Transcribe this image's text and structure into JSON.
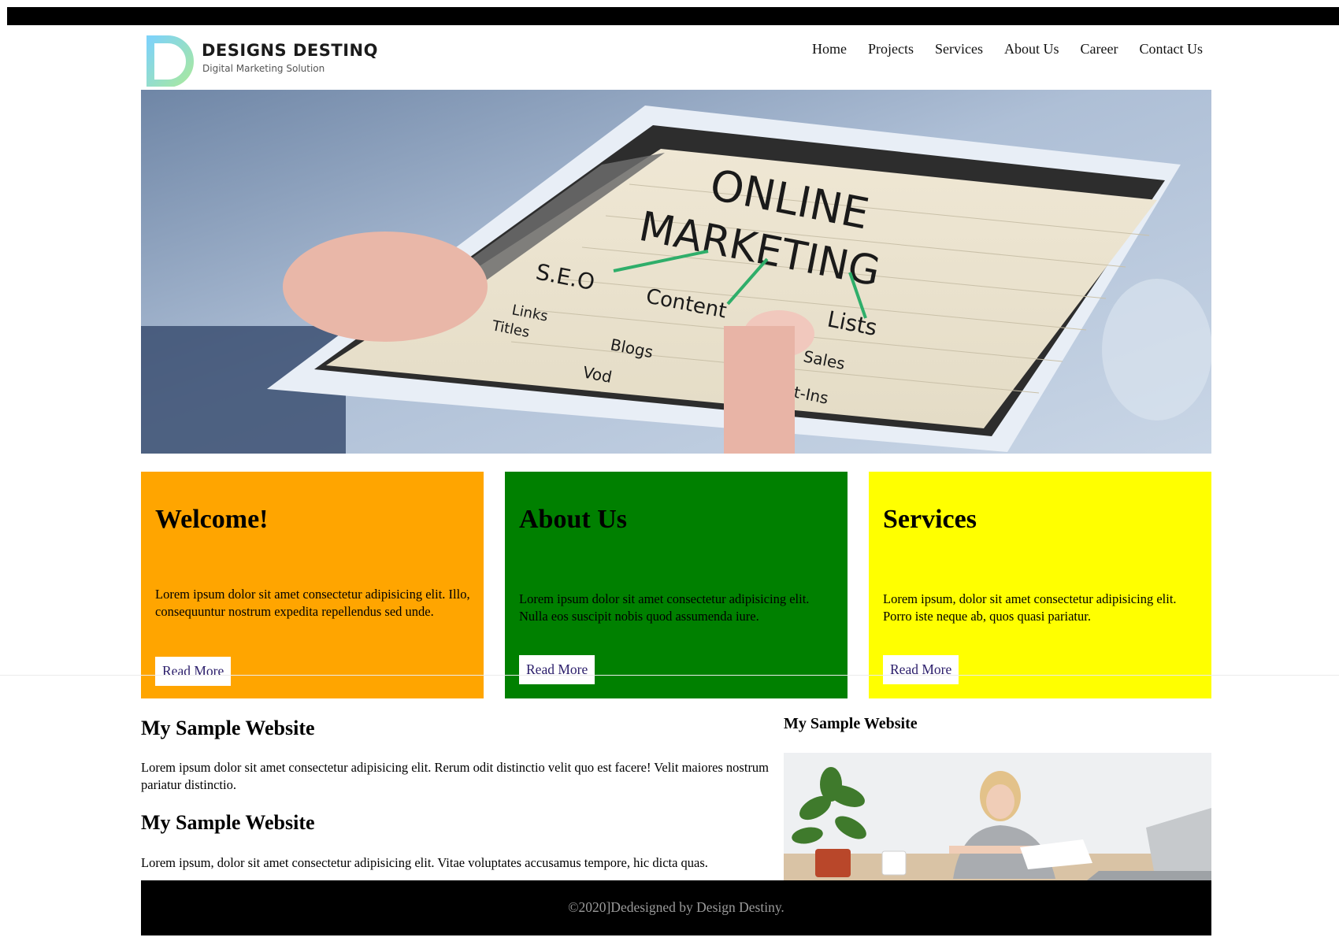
{
  "brand": {
    "name": "DESIGNS DESTINQ",
    "tagline": "Digital Marketing Solution"
  },
  "nav": [
    {
      "label": "Home"
    },
    {
      "label": "Projects"
    },
    {
      "label": "Services"
    },
    {
      "label": "About Us"
    },
    {
      "label": "Career"
    },
    {
      "label": "Contact Us"
    }
  ],
  "hero": {
    "screen_title": [
      "ONLINE",
      "MARKETING"
    ],
    "labels": [
      "S.E.O",
      "Content",
      "Lists",
      "Links",
      "Titles",
      "Blogs",
      "Sales",
      "Opt-Ins",
      "Vod"
    ]
  },
  "cards": [
    {
      "title": "Welcome!",
      "text": "Lorem ipsum dolor sit amet consectetur adipisicing elit. Illo, consequuntur nostrum expedita repellendus sed unde.",
      "button": "Read More",
      "color": "#ffa500"
    },
    {
      "title": "About Us",
      "text": "Lorem ipsum dolor sit amet consectetur adipisicing elit. Nulla eos suscipit nobis quod assumenda iure.",
      "button": "Read More",
      "color": "#008000"
    },
    {
      "title": "Services",
      "text": "Lorem ipsum, dolor sit amet consectetur adipisicing elit. Porro iste neque ab, quos quasi pariatur.",
      "button": "Read More",
      "color": "#ffff00"
    }
  ],
  "main": {
    "sections": [
      {
        "heading": "My Sample Website",
        "text": "Lorem ipsum dolor sit amet consectetur adipisicing elit. Rerum odit distinctio velit quo est facere! Velit maiores nostrum pariatur distinctio."
      },
      {
        "heading": "My Sample Website",
        "text": "Lorem ipsum, dolor sit amet consectetur adipisicing elit. Vitae voluptates accusamus tempore, hic dicta quas."
      }
    ]
  },
  "sidebar": {
    "heading": "My Sample Website"
  },
  "footer": {
    "text": "©2020]Dedesigned by Design Destiny."
  }
}
